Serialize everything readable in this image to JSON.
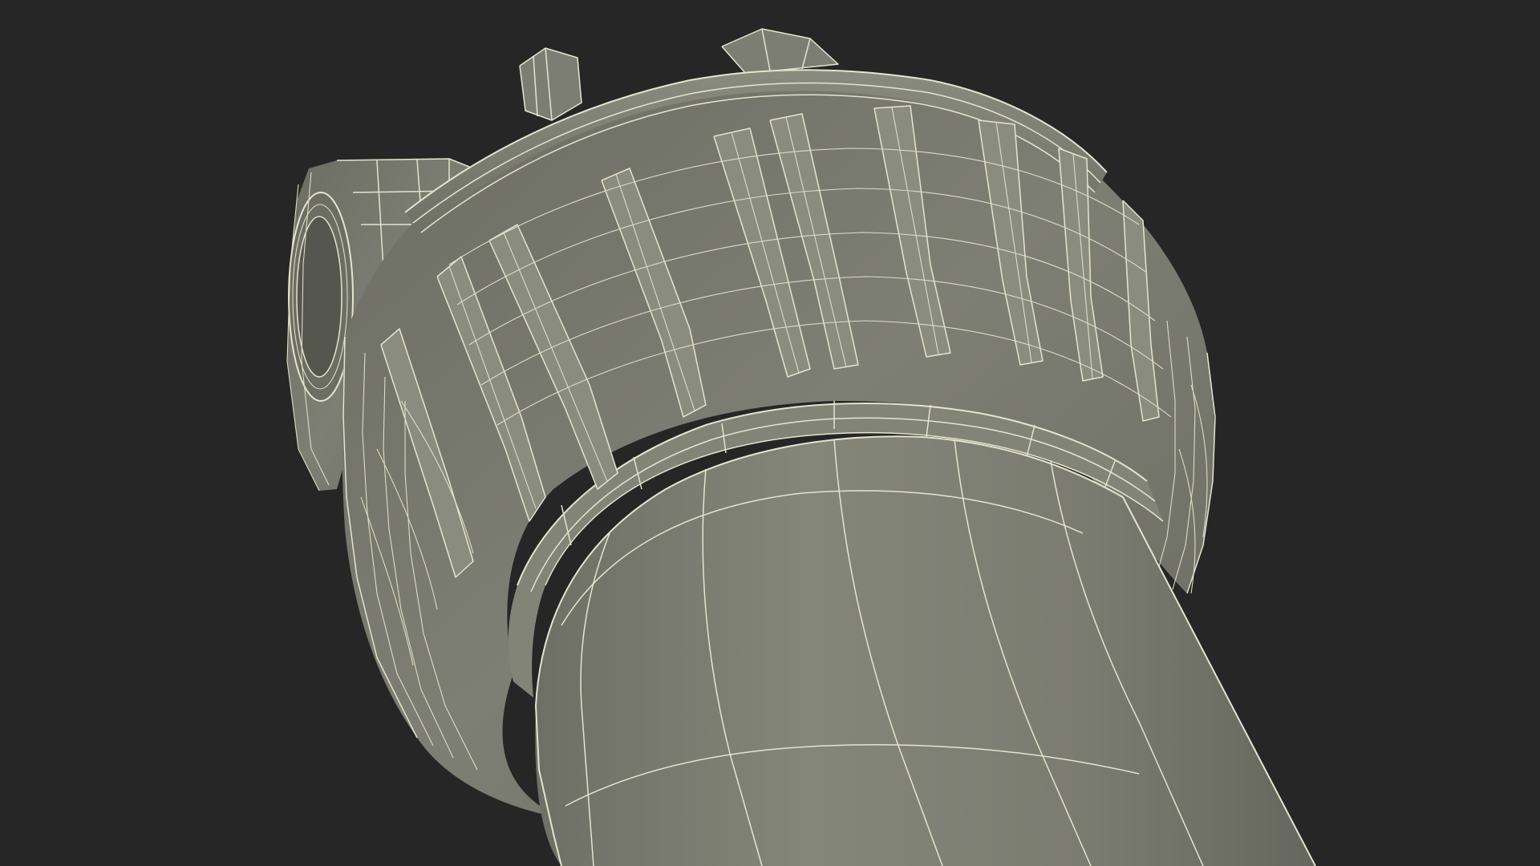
{
  "scene": {
    "background_color": "#262626",
    "surface_color": "#7a7b70",
    "wire_color": "#e4e4cf",
    "shadow_color": "#55564d"
  }
}
